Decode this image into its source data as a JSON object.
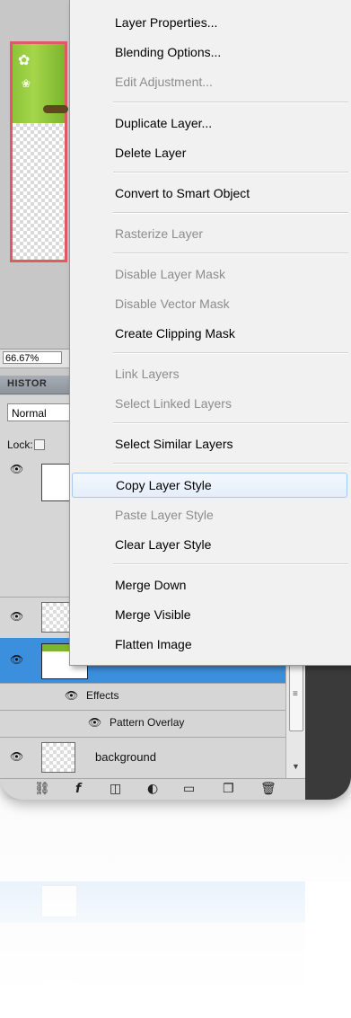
{
  "canvas": {
    "zoom": "66.67%"
  },
  "panel": {
    "history_tab": "HISTOR",
    "blend_mode": "Normal",
    "lock_label": "Lock:"
  },
  "layers": [
    {
      "name": "background"
    }
  ],
  "layer_effects": {
    "effects_label": "Effects",
    "pattern_overlay_label": "Pattern Overlay",
    "fx": "fx"
  },
  "menu": {
    "items": [
      {
        "label": "Layer Properties...",
        "disabled": false
      },
      {
        "label": "Blending Options...",
        "disabled": false
      },
      {
        "label": "Edit Adjustment...",
        "disabled": true
      },
      {
        "label": "Duplicate Layer...",
        "disabled": false
      },
      {
        "label": "Delete Layer",
        "disabled": false
      },
      {
        "label": "Convert to Smart Object",
        "disabled": false
      },
      {
        "label": "Rasterize Layer",
        "disabled": true
      },
      {
        "label": "Disable Layer Mask",
        "disabled": true
      },
      {
        "label": "Disable Vector Mask",
        "disabled": true
      },
      {
        "label": "Create Clipping Mask",
        "disabled": false
      },
      {
        "label": "Link Layers",
        "disabled": true
      },
      {
        "label": "Select Linked Layers",
        "disabled": true
      },
      {
        "label": "Select Similar Layers",
        "disabled": false
      },
      {
        "label": "Copy Layer Style",
        "disabled": false,
        "highlighted": true
      },
      {
        "label": "Paste Layer Style",
        "disabled": true
      },
      {
        "label": "Clear Layer Style",
        "disabled": false
      },
      {
        "label": "Merge Down",
        "disabled": false
      },
      {
        "label": "Merge Visible",
        "disabled": false
      },
      {
        "label": "Flatten Image",
        "disabled": false
      }
    ]
  },
  "footer_icons": [
    "link-icon",
    "fx-icon",
    "mask-icon",
    "adjustment-icon",
    "folder-icon",
    "new-layer-icon",
    "trash-icon"
  ],
  "colors": {
    "selection_blue": "#3b8fdc",
    "canvas_border": "#e15a63",
    "menu_highlight": "#e4eefa"
  }
}
